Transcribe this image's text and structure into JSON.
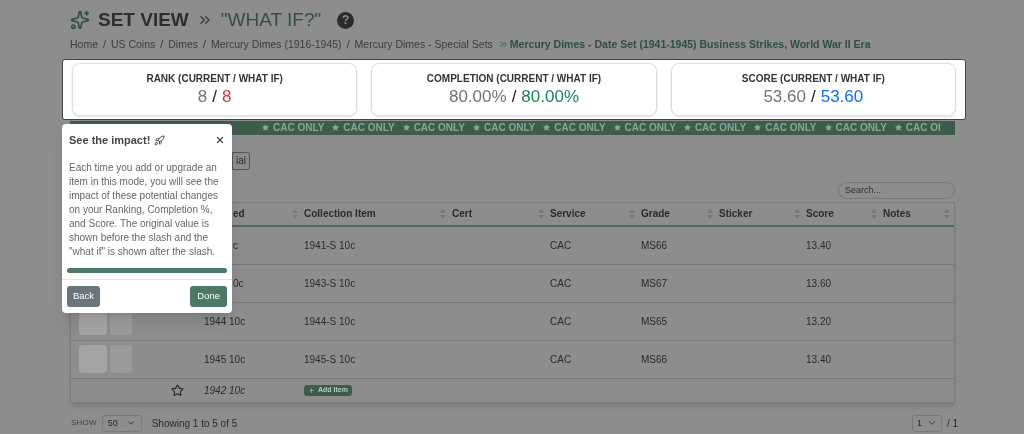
{
  "header": {
    "title": "SET VIEW",
    "mode": "\"WHAT IF?\""
  },
  "help": "?",
  "breadcrumb": {
    "separator": "/",
    "links": [
      "Home",
      "US Coins",
      "Dimes",
      "Mercury Dimes (1916-1945)",
      "Mercury Dimes - Special Sets"
    ],
    "current": "Mercury Dimes - Date Set (1941-1945) Business Strikes, World War II Era"
  },
  "stats_separator": "/",
  "stats": [
    {
      "label": "RANK (CURRENT / WHAT IF)",
      "current": "8",
      "what_if": "8",
      "color": "#dc3545"
    },
    {
      "label": "COMPLETION (CURRENT / WHAT IF)",
      "current": "80.00%",
      "what_if": "80.00%",
      "color": "#198754"
    },
    {
      "label": "SCORE (CURRENT / WHAT IF)",
      "current": "53.60",
      "what_if": "53.60",
      "color": "#0d6efd"
    }
  ],
  "banner": [
    "CAC ONLY",
    "CAC ONLY",
    "CAC ONLY",
    "CAC ONLY",
    "CAC ONLY",
    "CAC ONLY",
    "CAC ONLY",
    "CAC ONLY",
    "CAC ONLY",
    "CAC OI"
  ],
  "partial_button": "ial",
  "search": {
    "placeholder": "Search..."
  },
  "table": {
    "columns": [
      "ed",
      "Collection Item",
      "Cert",
      "Service",
      "Grade",
      "Sticker",
      "Score",
      "Notes"
    ],
    "rows": [
      {
        "kind": "item",
        "slot": "c",
        "item": "1941-S 10c",
        "service": "CAC",
        "grade": "MS66",
        "score": "13.40"
      },
      {
        "kind": "item",
        "slot": "0c",
        "item": "1943-S 10c",
        "service": "CAC",
        "grade": "MS67",
        "score": "13.60"
      },
      {
        "kind": "item",
        "photos": true,
        "slot": "1944 10c",
        "item": "1944-S 10c",
        "service": "CAC",
        "grade": "MS65",
        "score": "13.20"
      },
      {
        "kind": "item",
        "photos": true,
        "slot": "1945 10c",
        "item": "1945-S 10c",
        "service": "CAC",
        "grade": "MS66",
        "score": "13.40"
      },
      {
        "kind": "missing",
        "starred": false,
        "slot": "1942 10c",
        "action": "Add Item"
      }
    ]
  },
  "footer": {
    "show_label": "SHOW",
    "page_size": "50",
    "summary": "Showing 1 to 5 of 5",
    "page": "1",
    "page_total": "/ 1"
  },
  "popover": {
    "title": "See the impact!",
    "body": "Each time you add or upgrade an item in this mode, you will see the impact of these potential changes on your Ranking, Completion %, and Score. The original value is shown before the slash and the \"what if\" is shown after the slash.",
    "level": 1,
    "back": "Back",
    "done": "Done"
  }
}
